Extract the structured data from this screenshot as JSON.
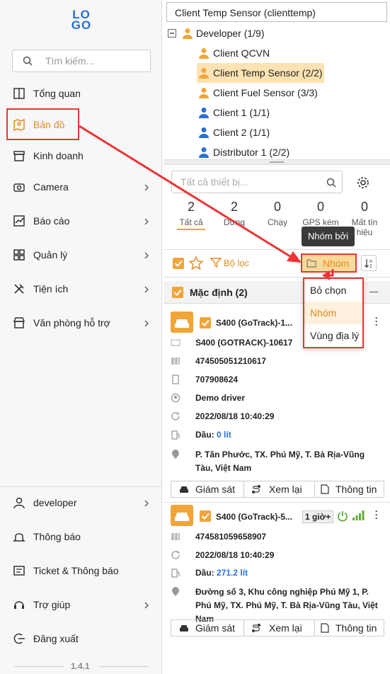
{
  "sidebar": {
    "logo": "LOGO",
    "search_placeholder": "Tìm kiếm...",
    "items": [
      {
        "label": "Tổng quan"
      },
      {
        "label": "Bản đồ"
      },
      {
        "label": "Kinh doanh"
      },
      {
        "label": "Camera"
      },
      {
        "label": "Báo cáo"
      },
      {
        "label": "Quản lý"
      },
      {
        "label": "Tiện ích"
      },
      {
        "label": "Văn phòng hỗ trợ"
      }
    ],
    "bottom": [
      {
        "label": "developer"
      },
      {
        "label": "Thông báo"
      },
      {
        "label": "Ticket & Thông báo"
      },
      {
        "label": "Trợ giúp"
      },
      {
        "label": "Đăng xuất"
      }
    ],
    "version": "1.4.1"
  },
  "tree": {
    "selected": "Client Temp Sensor (clienttemp)",
    "root": "Developer (1/9)",
    "nodes": [
      "Client QCVN",
      "Client Temp Sensor (2/2)",
      "Client Fuel Sensor (3/3)",
      "Client 1 (1/1)",
      "Client 2 (1/1)",
      "Distributor 1 (2/2)"
    ]
  },
  "devices": {
    "search_placeholder": "Tất cả thiết bị...",
    "stats": [
      {
        "value": "2",
        "label": "Tất cả"
      },
      {
        "value": "2",
        "label": "Dừng"
      },
      {
        "value": "0",
        "label": "Chạy"
      },
      {
        "value": "0",
        "label": "GPS kém"
      },
      {
        "value": "0",
        "label": "Mất tín hiệu"
      }
    ],
    "tooltip": "Nhóm bởi",
    "filter_label": "Bộ lọc",
    "group_button": "Nhóm",
    "group_menu": [
      "Bỏ chọn",
      "Nhóm",
      "Vùng địa lý"
    ],
    "group_title": "Mặc định (2)",
    "cards": [
      {
        "name": "S400 (GoTrack)-1...",
        "model": "S400 (GOTRACK)-10617",
        "imei": "474505051210617",
        "phone": "707908624",
        "driver": "Demo driver",
        "time": "2022/08/18 10:40:29",
        "fuel_label": "Dầu:",
        "fuel_value": "0 lít",
        "address": "P. Tân Phước, TX. Phú Mỹ, T. Bà Rịa-Vũng Tàu, Việt Nam"
      },
      {
        "name": "S400 (GoTrack)-5...",
        "badge": "1 giờ+",
        "imei": "474581059658907",
        "time": "2022/08/18 10:40:29",
        "fuel_label": "Dầu:",
        "fuel_value": "271.2 lít",
        "address": "Đường số 3, Khu công nghiệp Phú Mỹ 1, P. Phú Mỹ, TX. Phú Mỹ, T. Bà Rịa-Vũng Tàu, Việt Nam"
      }
    ],
    "actions": [
      "Giám sát",
      "Xem lại",
      "Thông tin"
    ]
  },
  "colors": {
    "accent": "#f0a53a",
    "highlight": "#e33333",
    "link": "#2a6fd6"
  }
}
